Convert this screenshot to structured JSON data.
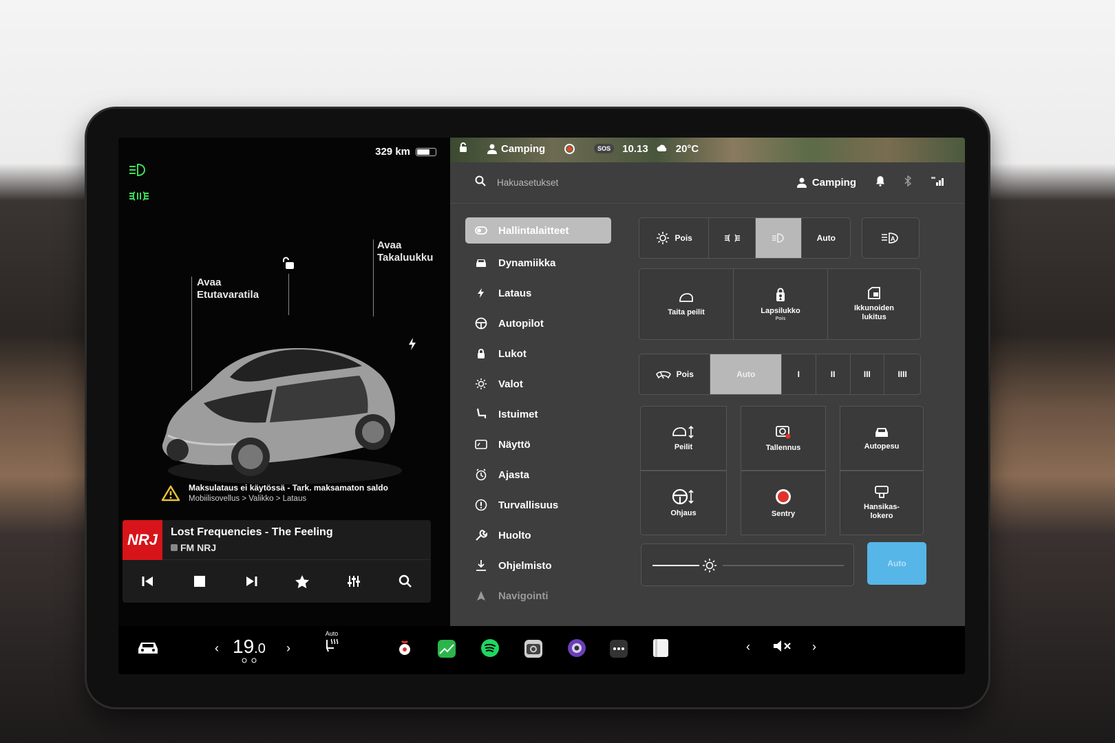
{
  "car": {
    "range": "329 km",
    "battery_level": 0.7,
    "frunk_label": "Avaa\nEtutavaratila",
    "trunk_label": "Avaa\nTakaluukku",
    "warning_line1": "Maksulataus ei käytössä - Tark. maksamaton saldo",
    "warning_line2": "Mobiilisovellus > Valikko > Lataus"
  },
  "media": {
    "station_logo": "NRJ",
    "track": "Lost Frequencies - The Feeling",
    "source": "FM NRJ"
  },
  "topbar": {
    "profile": "Camping",
    "sos": "SOS",
    "time": "10.13",
    "outside_temp": "20°C"
  },
  "search": {
    "placeholder": "Hakuasetukset",
    "profile": "Camping"
  },
  "menu": [
    {
      "label": "Hallintalaitteet",
      "icon": "toggle-icon"
    },
    {
      "label": "Dynamiikka",
      "icon": "car-icon"
    },
    {
      "label": "Lataus",
      "icon": "bolt-icon"
    },
    {
      "label": "Autopilot",
      "icon": "steering-wheel-icon"
    },
    {
      "label": "Lukot",
      "icon": "lock-icon"
    },
    {
      "label": "Valot",
      "icon": "sun-icon"
    },
    {
      "label": "Istuimet",
      "icon": "seat-icon"
    },
    {
      "label": "Näyttö",
      "icon": "display-icon"
    },
    {
      "label": "Ajasta",
      "icon": "clock-icon"
    },
    {
      "label": "Turvallisuus",
      "icon": "info-icon"
    },
    {
      "label": "Huolto",
      "icon": "wrench-icon"
    },
    {
      "label": "Ohjelmisto",
      "icon": "download-icon"
    },
    {
      "label": "Navigointi",
      "icon": "navigation-icon"
    }
  ],
  "lights": {
    "off": "Pois",
    "auto": "Auto",
    "selected": "low-beam"
  },
  "tiles_row1": [
    {
      "label": "Taita peilit",
      "sub": ""
    },
    {
      "label": "Lapsilukko",
      "sub": "Pois"
    },
    {
      "label": "Ikkunoiden\nlukitus",
      "sub": ""
    }
  ],
  "wipers": {
    "off": "Pois",
    "auto": "Auto",
    "levels": [
      "I",
      "II",
      "III",
      "IIII"
    ],
    "selected": "Auto"
  },
  "tiles_grid": [
    {
      "label": "Peilit",
      "icon": "mirror-adjust-icon"
    },
    {
      "label": "Tallennus",
      "icon": "dashcam-icon"
    },
    {
      "label": "Autopesu",
      "icon": "car-wash-icon"
    },
    {
      "label": "Ohjaus",
      "icon": "steering-adjust-icon"
    },
    {
      "label": "Sentry",
      "icon": "sentry-icon"
    },
    {
      "label": "Hansikas-\nlokero",
      "icon": "glovebox-icon"
    }
  ],
  "brightness": {
    "level": 0.3,
    "auto_label": "Auto"
  },
  "dock": {
    "cabin_temp_int": "19",
    "cabin_temp_dec": ".0",
    "seat_heater_label": "Auto"
  },
  "colors": {
    "accent_green": "#3fdc5a",
    "auto_blue": "#56b6e8",
    "sentry_red": "#e0332b",
    "nrj_red": "#d7141a"
  }
}
